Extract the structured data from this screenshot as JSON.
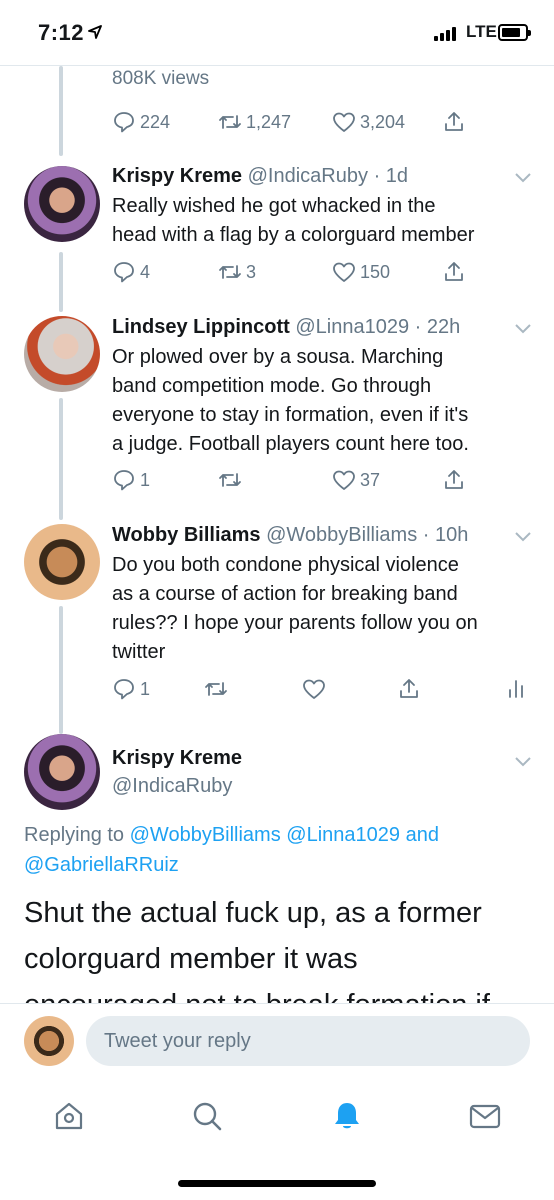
{
  "status": {
    "time": "7:12",
    "network": "LTE"
  },
  "top_tweet": {
    "views": "808K views",
    "replies": "224",
    "retweets": "1,247",
    "likes": "3,204"
  },
  "tweets": [
    {
      "name": "Krispy Kreme",
      "handle": "@IndicaRuby",
      "time": "· 1d",
      "lines": [
        "Really wished he got whacked in the",
        "head with a flag by a colorguard member"
      ],
      "replies": "4",
      "retweets": "3",
      "likes": "150"
    },
    {
      "name": "Lindsey Lippincott",
      "handle": "@Linna1029",
      "time": "· 22h",
      "lines": [
        "Or plowed over by a sousa. Marching",
        "band competition mode. Go through",
        "everyone to stay in formation, even if it's",
        "a judge. Football players count here too."
      ],
      "replies": "1",
      "retweets": "",
      "likes": "37"
    },
    {
      "name": "Wobby Billiams",
      "handle": "@WobbyBilliams",
      "time": "· 10h",
      "lines": [
        "Do you both condone physical violence",
        "as a course of action for breaking band",
        "rules?? I hope your parents follow you on",
        "twitter"
      ],
      "replies": "1",
      "retweets": "",
      "likes": ""
    }
  ],
  "focused_tweet": {
    "name": "Krispy Kreme",
    "handle": "@IndicaRuby",
    "replying_prefix": "Replying to",
    "mentions": [
      "@WobbyBilliams",
      "@Linna1029",
      "@GabriellaRRuiz"
    ],
    "and_word": "and",
    "text_lines": [
      "Shut the actual fuck up, as a former",
      "colorguard member it was",
      "encouraged not to break formation if"
    ]
  },
  "compose": {
    "placeholder": "Tweet your reply"
  },
  "tabs": [
    "home-icon",
    "search-icon",
    "notifications-icon",
    "messages-icon"
  ],
  "colors": {
    "accent": "#1da1f2",
    "muted": "#657786",
    "text": "#14171a",
    "thread": "#ccd6dd"
  }
}
